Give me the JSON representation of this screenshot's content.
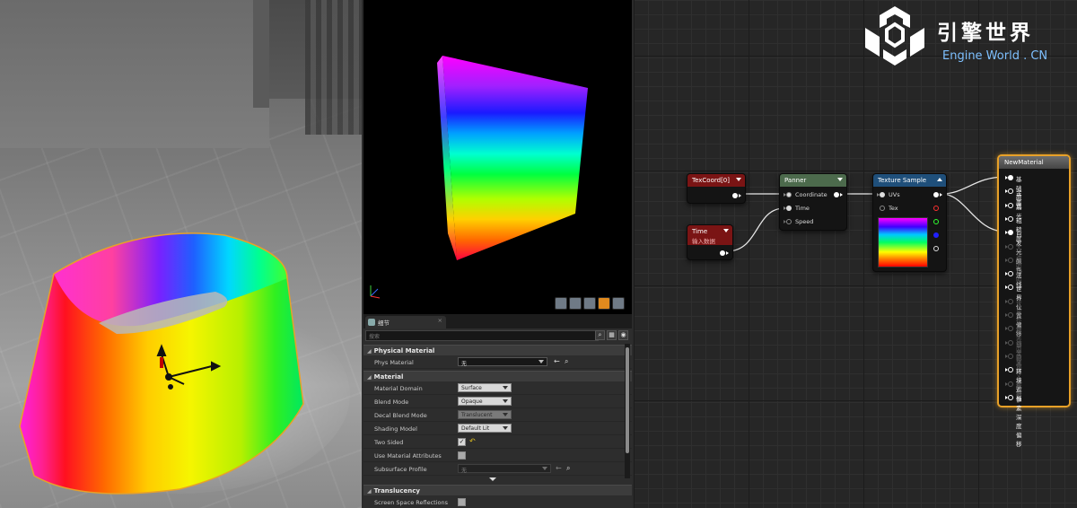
{
  "details_panel": {
    "tab_label": "细节",
    "tab_close": "×",
    "search_placeholder": "搜索",
    "search_icon": "⌕",
    "view_options_icon": "👁",
    "sections": {
      "physical_material": "Physical Material",
      "material": "Material",
      "translucency": "Translucency"
    },
    "properties": {
      "phys_material": {
        "label": "Phys Material",
        "value": "无"
      },
      "material_domain": {
        "label": "Material Domain",
        "value": "Surface"
      },
      "blend_mode": {
        "label": "Blend Mode",
        "value": "Opaque"
      },
      "decal_blend_mode": {
        "label": "Decal Blend Mode",
        "value": "Translucent"
      },
      "shading_model": {
        "label": "Shading Model",
        "value": "Default Lit"
      },
      "two_sided": {
        "label": "Two Sided",
        "checked": true,
        "check_glyph": "✓",
        "reset_glyph": "↶"
      },
      "use_material_attributes": {
        "label": "Use Material Attributes",
        "checked": false
      },
      "subsurface_profile": {
        "label": "Subsurface Profile",
        "value": "无"
      },
      "screen_space_reflections": {
        "label": "Screen Space Reflections",
        "checked": false
      }
    },
    "nav_back_glyph": "←",
    "browse_glyph": "⌕"
  },
  "material_graph": {
    "nodes": {
      "texcoord": {
        "title": "TexCoord[0]",
        "header_color": "#7a1414"
      },
      "time": {
        "title": "Time",
        "subtitle": "输入数据",
        "header_color": "#7a1414"
      },
      "panner": {
        "title": "Panner",
        "header_color": "#4c6a4c",
        "pins": [
          "Coordinate",
          "Time",
          "Speed"
        ]
      },
      "texture_sample": {
        "title": "Texture Sample",
        "header_color": "#1f4f7a",
        "pins": [
          "UVs",
          "Tex"
        ]
      },
      "new_material": {
        "title": "NewMaterial",
        "pins": [
          {
            "label": "基础颜色",
            "enabled": true,
            "connected": true
          },
          {
            "label": "金属",
            "enabled": true,
            "connected": false
          },
          {
            "label": "高光",
            "enabled": true,
            "connected": false
          },
          {
            "label": "粗糙度",
            "enabled": true,
            "connected": false
          },
          {
            "label": "自发光颜色",
            "enabled": true,
            "connected": true
          },
          {
            "label": "不透明度",
            "enabled": false,
            "connected": false
          },
          {
            "label": "不透明蒙板",
            "enabled": false,
            "connected": false
          },
          {
            "label": "法线",
            "enabled": true,
            "connected": false
          },
          {
            "label": "世界位置偏移",
            "enabled": true,
            "connected": false
          },
          {
            "label": "世界位移",
            "enabled": false,
            "connected": false
          },
          {
            "label": "多边形细分乘数",
            "enabled": false,
            "connected": false
          },
          {
            "label": "次表面颜色",
            "enabled": false,
            "connected": false
          },
          {
            "label": "自定义数据0",
            "enabled": false,
            "connected": false
          },
          {
            "label": "自定义数据1",
            "enabled": false,
            "connected": false
          },
          {
            "label": "环境遮挡",
            "enabled": true,
            "connected": false
          },
          {
            "label": "折射",
            "enabled": false,
            "connected": false
          },
          {
            "label": "像素深度偏移",
            "enabled": true,
            "connected": false
          }
        ]
      }
    }
  },
  "logo": {
    "name_cn": "引擎世界",
    "name_en": "Engine World . CN"
  },
  "colors": {
    "accent_orange": "#e8a128",
    "logo_blue": "#7ec0ff"
  }
}
